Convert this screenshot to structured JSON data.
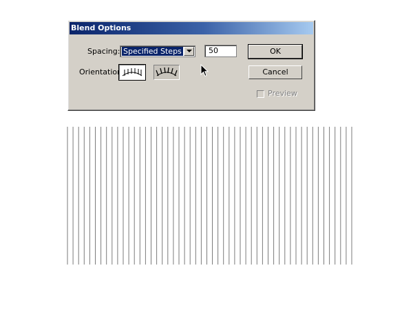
{
  "dialog": {
    "title": "Blend Options",
    "spacing_label": "Spacing:",
    "spacing_value": "Specified Steps",
    "steps_value": "50",
    "orientation_label": "Orientation",
    "ok_label": "OK",
    "cancel_label": "Cancel",
    "preview_label": "Preview",
    "preview_checked": false,
    "preview_enabled": false,
    "orientation_options": [
      "align-to-page-icon",
      "align-to-path-icon"
    ],
    "orientation_selected": "align-to-page-icon"
  },
  "canvas": {
    "blend_line_count": 52,
    "line_color": "#7a7a7a"
  },
  "colors": {
    "dialog_bg": "#d4d0c8",
    "title_start": "#0a246a",
    "title_end": "#a6caf0",
    "selection": "#0a246a"
  }
}
